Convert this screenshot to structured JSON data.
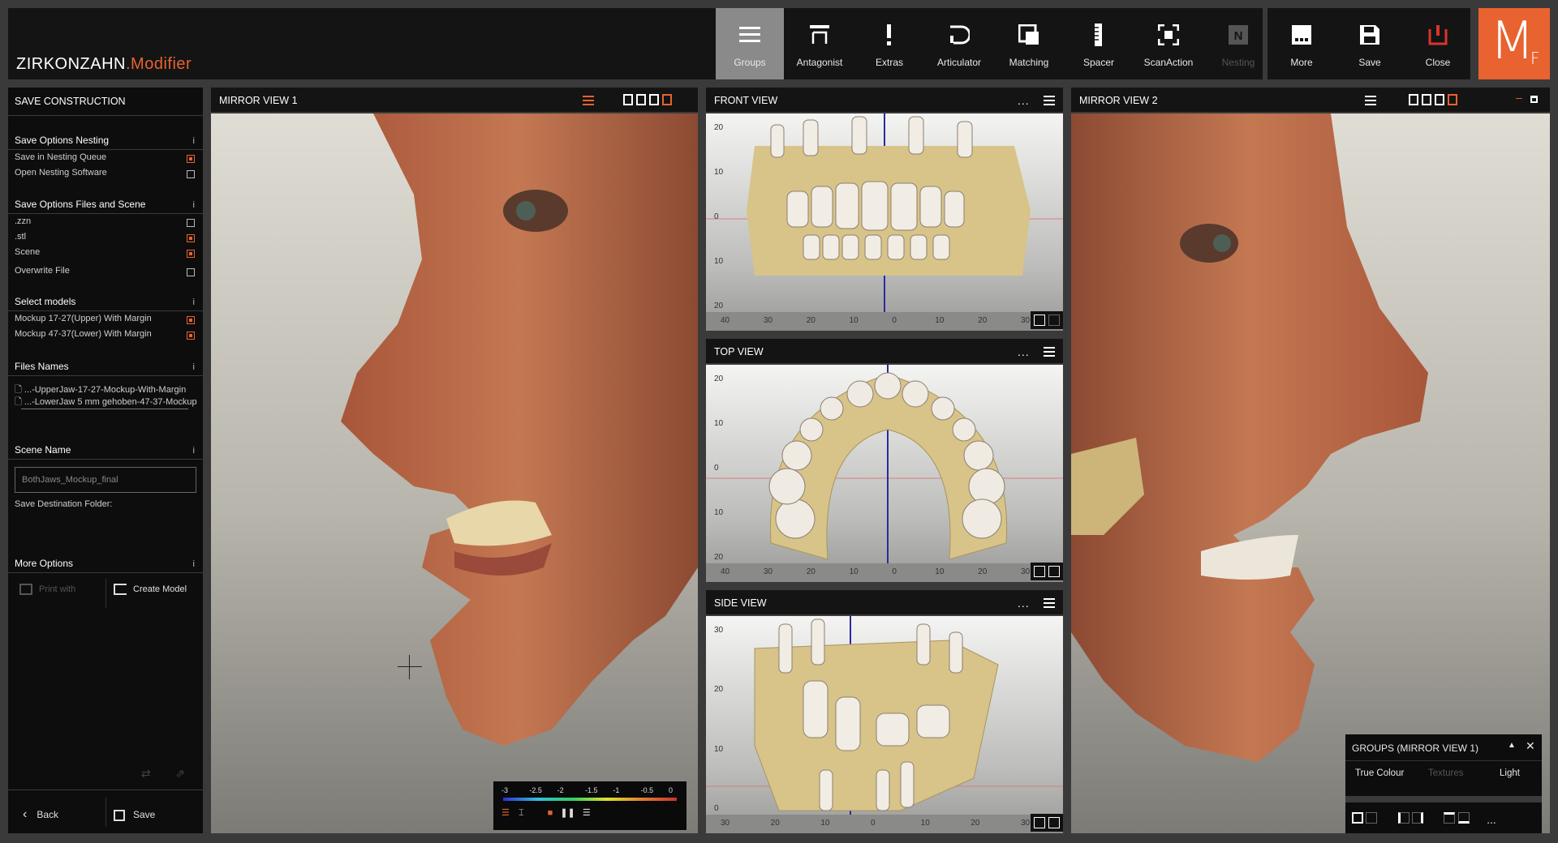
{
  "app": {
    "brand": "ZIRKONZAHN",
    "brand_module": ".Modifier",
    "logo_main": "M",
    "logo_sub": "F",
    "accent": "#e8632f"
  },
  "toolbar": {
    "groups": "Groups",
    "antagonist": "Antagonist",
    "extras": "Extras",
    "articulator": "Articulator",
    "matching": "Matching",
    "spacer": "Spacer",
    "scanaction": "ScanAction",
    "nesting": "Nesting",
    "more": "More",
    "save": "Save",
    "close": "Close"
  },
  "left_panel": {
    "title": "SAVE CONSTRUCTION",
    "info": "i",
    "nesting": {
      "header": "Save Options Nesting",
      "save_queue": "Save in Nesting Queue",
      "open_software": "Open Nesting Software"
    },
    "files": {
      "header": "Save Options Files and Scene",
      "zzn": ".zzn",
      "stl": ".stl",
      "scene": "Scene",
      "overwrite": "Overwrite File"
    },
    "models": {
      "header": "Select models",
      "upper": "Mockup 17-27(Upper) With Margin",
      "lower": "Mockup 47-37(Lower) With Margin"
    },
    "file_names": {
      "header": "Files Names",
      "file1": "...-UpperJaw-17-27-Mockup-With-Margin",
      "file2": "...-LowerJaw 5 mm gehoben-47-37-Mockup"
    },
    "scene_name": {
      "header": "Scene Name",
      "value": "BothJaws_Mockup_final",
      "dest": "Save Destination Folder:"
    },
    "more_options": {
      "header": "More Options",
      "print": "Print with",
      "create_model": "Create Model"
    },
    "back": "Back",
    "save": "Save"
  },
  "views": {
    "mirror1": "MIRROR VIEW 1",
    "front": "FRONT VIEW",
    "top": "TOP VIEW",
    "side": "SIDE VIEW",
    "mirror2": "MIRROR VIEW 2",
    "dots": "..."
  },
  "rulers": {
    "front_x": [
      "40",
      "30",
      "20",
      "10",
      "0",
      "10",
      "20",
      "30"
    ],
    "front_y": [
      "20",
      "10",
      "0",
      "10",
      "20"
    ],
    "top_x": [
      "40",
      "30",
      "20",
      "10",
      "0",
      "10",
      "20",
      "30"
    ],
    "top_y": [
      "20",
      "10",
      "0",
      "10",
      "20"
    ],
    "side_x": [
      "30",
      "20",
      "10",
      "0",
      "10",
      "20",
      "30"
    ],
    "side_y": [
      "30",
      "20",
      "10",
      "0"
    ]
  },
  "colorbar": {
    "ticks": [
      "-3",
      "-2.5",
      "-2",
      "-1.5",
      "-1",
      "-0.5",
      "0"
    ]
  },
  "groups_panel": {
    "title": "GROUPS (MIRROR VIEW 1)",
    "true_colour": "True Colour",
    "textures": "Textures",
    "light": "Light",
    "more": "..."
  }
}
